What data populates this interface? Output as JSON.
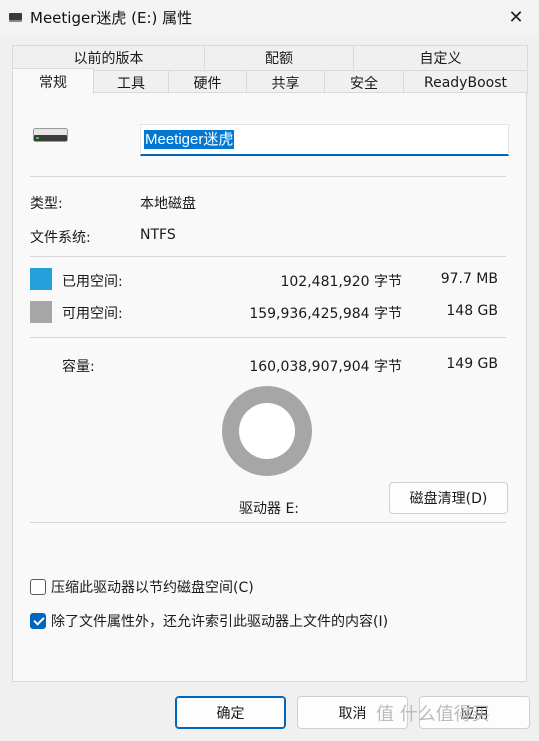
{
  "window": {
    "title": "Meetiger迷虎 (E:) 属性",
    "close_glyph": "✕"
  },
  "tabs_row1": [
    {
      "label": "以前的版本"
    },
    {
      "label": "配额"
    },
    {
      "label": "自定义"
    }
  ],
  "tabs_row2": [
    {
      "label": "常规",
      "active": true
    },
    {
      "label": "工具"
    },
    {
      "label": "硬件"
    },
    {
      "label": "共享"
    },
    {
      "label": "安全"
    },
    {
      "label": "ReadyBoost"
    }
  ],
  "general": {
    "drive_name": "Meetiger迷虎",
    "type_label": "类型:",
    "type_value": "本地磁盘",
    "fs_label": "文件系统:",
    "fs_value": "NTFS",
    "used": {
      "label": "已用空间:",
      "bytes": "102,481,920 字节",
      "size": "97.7 MB",
      "color": "#26a0da"
    },
    "free": {
      "label": "可用空间:",
      "bytes": "159,936,425,984 字节",
      "size": "148 GB",
      "color": "#a6a6a6"
    },
    "capacity": {
      "label": "容量:",
      "bytes": "160,038,907,904 字节",
      "size": "149 GB"
    },
    "drive_label": "驱动器 E:",
    "cleanup_button": "磁盘清理(D)",
    "compress_checkbox": {
      "label": "压缩此驱动器以节约磁盘空间(C)",
      "checked": false
    },
    "index_checkbox": {
      "label": "除了文件属性外，还允许索引此驱动器上文件的内容(I)",
      "checked": true
    }
  },
  "footer": {
    "ok": "确定",
    "cancel": "取消",
    "apply": "应用"
  },
  "watermark": "值 什么值得买"
}
